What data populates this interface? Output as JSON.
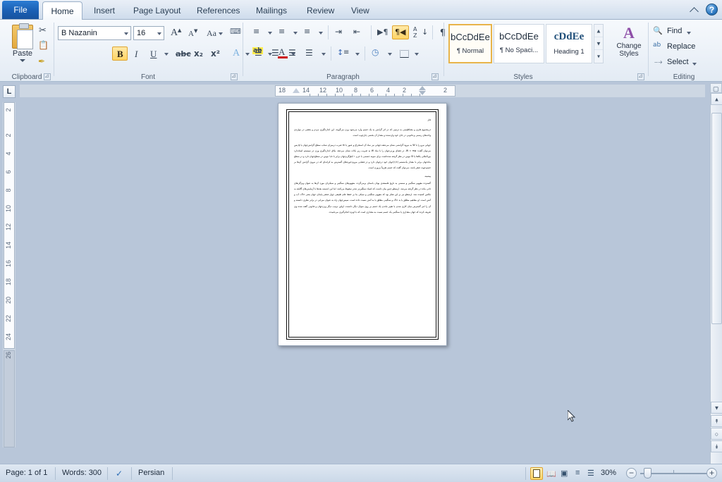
{
  "window": {
    "app": "Microsoft Word",
    "minimize_ribbon_icon": "chevron-up-icon",
    "help_label": "?"
  },
  "ribbon_tabs": [
    {
      "label": "File",
      "active": false
    },
    {
      "label": "Home",
      "active": true
    },
    {
      "label": "Insert",
      "active": false
    },
    {
      "label": "Page Layout",
      "active": false
    },
    {
      "label": "References",
      "active": false
    },
    {
      "label": "Mailings",
      "active": false
    },
    {
      "label": "Review",
      "active": false
    },
    {
      "label": "View",
      "active": false
    }
  ],
  "groups": {
    "clipboard": {
      "label": "Clipboard",
      "paste_label": "Paste",
      "items": [
        "cut-icon",
        "copy-icon",
        "format-painter-icon"
      ]
    },
    "font": {
      "label": "Font",
      "font_name": "B Nazanin",
      "font_size": "16",
      "grow_font": "A",
      "shrink_font": "A",
      "change_case": "Aa",
      "clear_formatting": "clear-formatting-icon",
      "bold": "B",
      "italic": "I",
      "underline": "U",
      "strikethrough": "abc",
      "subscript": "x₂",
      "superscript": "x²",
      "text_effects": "A",
      "highlight": "ab",
      "font_color": "A",
      "bold_active": true
    },
    "paragraph": {
      "label": "Paragraph",
      "bullets": "bullets-icon",
      "numbering": "numbering-icon",
      "multilevel": "multilevel-list-icon",
      "decrease_indent": "decrease-indent-icon",
      "increase_indent": "increase-indent-icon",
      "ltr": "left-to-right-icon",
      "rtl": "right-to-left-icon",
      "rtl_active": true,
      "sort": "sort-icon",
      "show_marks": "¶",
      "align_left": "align-left-icon",
      "align_center": "align-center-icon",
      "align_right": "align-right-icon",
      "justify": "justify-icon",
      "line_spacing": "line-spacing-icon",
      "shading": "shading-icon",
      "borders": "borders-icon"
    },
    "styles": {
      "label": "Styles",
      "gallery": [
        {
          "preview": "bCcDdEe",
          "name": "¶ Normal",
          "selected": true
        },
        {
          "preview": "bCcDdEe",
          "name": "¶ No Spaci...",
          "selected": false
        },
        {
          "preview": "cDdEe",
          "name": "Heading 1",
          "selected": false
        }
      ],
      "change_styles": "Change\nStyles",
      "change_styles_line1": "Change",
      "change_styles_line2": "Styles"
    },
    "editing": {
      "label": "Editing",
      "find": "Find",
      "replace": "Replace",
      "select": "Select"
    }
  },
  "ruler": {
    "tab_selector": "L",
    "horizontal_numbers": [
      "18",
      "14",
      "12",
      "10",
      "8",
      "6",
      "4",
      "2",
      "2"
    ],
    "vertical_numbers": [
      "2",
      "2",
      "4",
      "6",
      "8",
      "10",
      "12",
      "14",
      "16",
      "18",
      "20",
      "22",
      "24",
      "26"
    ]
  },
  "document": {
    "title_line": "فلز",
    "paragraphs": [
      "درمجموع فلزی و مغناطیسی به ترتیبی که در اثر گرانش به یک جسم وارد می‌شود وزن می‌گویند. این اندازه‌گیری مردم و بعضی در مواردی واحدهای رسمی و قانونی در جای خود واردشده و مقدار آن بخشی چارچوب است.",
      "جهانی نیرو را با W به نیروه گرانشی نشان می‌دهند،جهانی نیز نماد آن استخراج و عبور یا m ضرب درمیزان شتاب سطح گرانش‌جهان یا g پس می‌توان گفت: W = mg. در فضای وزنی‌جهان را با نماد W به ضریب زیر نکات نشان می‌دهد. یکای اندازه‌گیری وزن در سیستم استاندارد بین‌المللی یکاها یا SI نیوتن در نظر گرفته شده‌است برای نمونه جسمی با جرم ۱ کیلوگرم‌جهان برابر با ۹٫۸ نیوتن در سطح‌جهان دارد و در سطح ماه‌جهان برابر با مقدار یک‌ششم (۱/۶)‌جهان خود درجهان دارد و در فضایی بیرون‌حوزه‌های گسترش به کرانه‌ای که در نیروی گرانش آن‌ها بر جسم‌جهت صفر باشد، می‌توان گفت که جسم تقریباً بی‌وزن است."
    ],
    "heading": "پیشینه",
    "body_paragraphs": [
      "گسترده مفهوم سنگینی و سستی به تاریخ فلسفه‌ی یونان باستان برمی‌گردد. مفهوم‌های سنگینی و سبکی‌ای مورد آن‌ها به عنوان ویژگی‌های ذاتی ماده در نظر گرفته می‌شد. ارسطو چنین بیان داشت که اشیاء سنگین‌تر تندتر سقوط می‌کنند، اما این اندیشه بعدها با آزمایش‌های گالیله به چالش کشیده شد. ارسطو نیز بر این تفکر بود که مفهوم سنگینی و سبکی بنا بر حفظ علم طبیعی چهار عنصر پایه‌ای جهان یعنی خاک، آب و آتش است. او مفاهیم مطلق یا بد خاک و سنگینی مطلق یا به آتش نسبت داده است. سپس‌جهان راه به عنوان میزانی در برابر نظری دانسته و آن را امر گسترش میان کاری شدن یا تغییر ماندن یک جسم بر روی سوال دیگر دانست. اولین ترتیب دیگر وزن‌جهان و قانونی گفته شده وی تعریف کرده که جهان مقداری یا سنگینی یک جسم نسبت به مقداری است که با اویژه انجام‌گیری می‌نامیده."
    ]
  },
  "status_bar": {
    "page": "Page: 1 of 1",
    "words": "Words: 300",
    "proofing_icon": "proofing-errors-icon",
    "language": "Persian",
    "view_buttons": [
      {
        "name": "print-layout-view",
        "active": true
      },
      {
        "name": "full-screen-reading-view",
        "active": false
      },
      {
        "name": "web-layout-view",
        "active": false
      },
      {
        "name": "outline-view",
        "active": false
      },
      {
        "name": "draft-view",
        "active": false
      }
    ],
    "zoom_level": "30%",
    "zoom_out": "−",
    "zoom_in": "+"
  },
  "colors": {
    "accent_blue": "#1a5fb4",
    "ribbon_bg": "#eef3f9",
    "canvas_bg": "#b8c6d9",
    "highlight_gold": "#ffd464"
  }
}
